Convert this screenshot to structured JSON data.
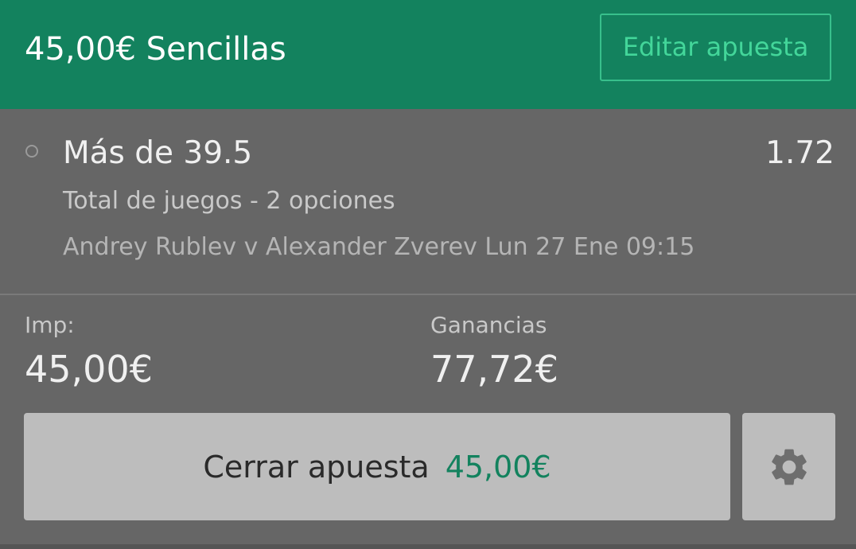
{
  "header": {
    "title": "45,00€ Sencillas",
    "edit_label": "Editar apuesta"
  },
  "selection": {
    "name": "Más de 39.5",
    "odds": "1.72",
    "market": "Total de juegos - 2 opciones",
    "event": "Andrey Rublev v Alexander Zverev Lun 27 Ene 09:15"
  },
  "summary": {
    "stake_label": "Imp:",
    "stake_value": "45,00€",
    "returns_label": "Ganancias",
    "returns_value": "77,72€"
  },
  "cashout": {
    "label": "Cerrar apuesta",
    "amount": "45,00€"
  },
  "icons": {
    "radio": "radio-unchecked-icon",
    "settings": "gear-icon"
  },
  "colors": {
    "brand_green": "#13825e",
    "accent_green": "#43d69a",
    "panel_gray": "#666666",
    "button_gray": "#bdbdbd"
  }
}
